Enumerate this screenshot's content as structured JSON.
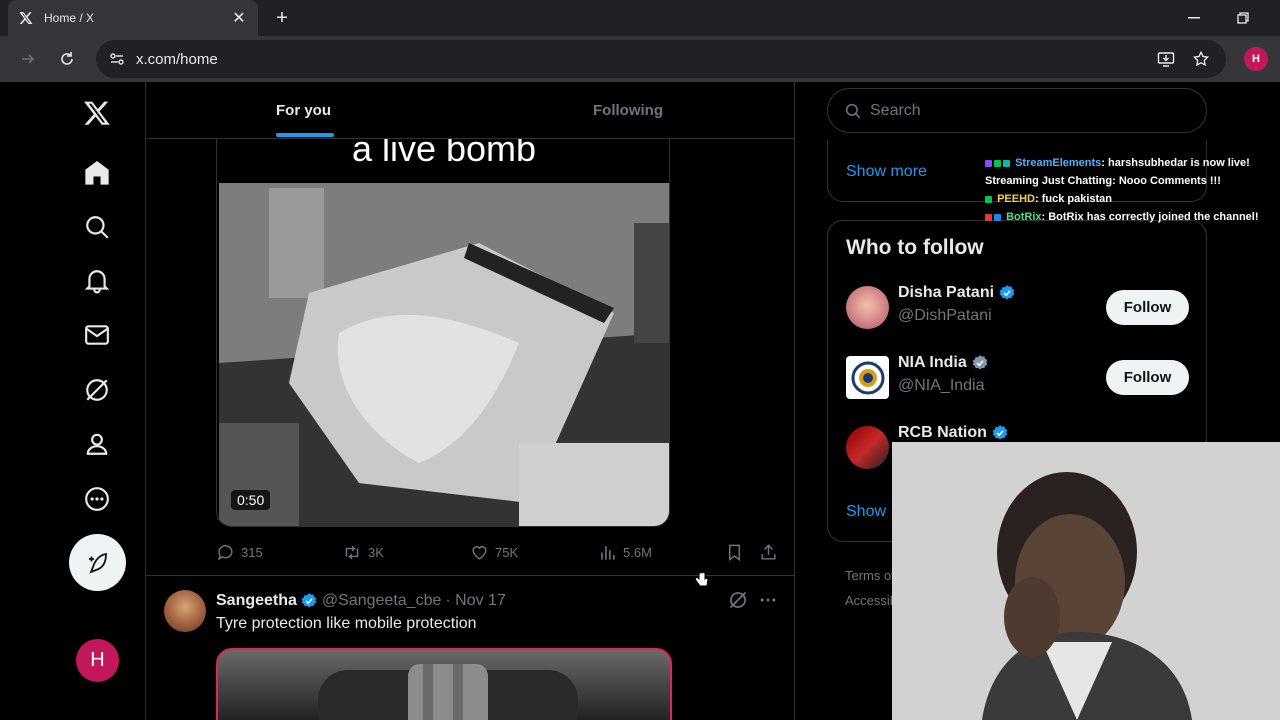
{
  "browser": {
    "tab_title": "Home / X",
    "url": "x.com/home",
    "profile_initial": "H"
  },
  "nav": {
    "user_initial": "H"
  },
  "feed": {
    "tabs": [
      {
        "label": "For you",
        "active": true
      },
      {
        "label": "Following",
        "active": false
      }
    ],
    "post1": {
      "media_caption": "a live bomb",
      "duration": "0:50",
      "replies": "315",
      "reposts": "3K",
      "likes": "75K",
      "views": "5.6M"
    },
    "post2": {
      "name": "Sangeetha",
      "handle": "@Sangeeta_cbe",
      "date": "· Nov 17",
      "text": "Tyre protection like mobile protection"
    }
  },
  "sidebar": {
    "search_placeholder": "Search",
    "show_more": "Show more",
    "who_to_follow": {
      "title": "Who to follow",
      "accounts": [
        {
          "name": "Disha Patani",
          "handle": "@DishPatani",
          "button": "Follow"
        },
        {
          "name": "NIA India",
          "handle": "@NIA_India",
          "button": "Follow"
        },
        {
          "name": "RCB Nation",
          "handle": "",
          "button": ""
        }
      ],
      "show_more": "Show"
    },
    "footer": {
      "line1": "Terms of",
      "line2": "Accessib"
    }
  },
  "chat": [
    {
      "user": "StreamElements",
      "message": ": harshsubhedar is now live! Streaming Just Chatting: Nooo Comments !!!"
    },
    {
      "user": "PEEHD",
      "message": ": fuck pakistan"
    },
    {
      "user": "BotRix",
      "message": ": BotRix has correctly joined the channel!"
    }
  ],
  "colors": {
    "accent": "#1d9bf0",
    "background": "#000000",
    "border": "#2f3336",
    "verified": "#1d9bf0",
    "verified_gov": "#829aab",
    "avatar_user": "#c2185b"
  },
  "icons": [
    "x-logo-icon",
    "home-icon",
    "search-icon",
    "bell-icon",
    "mail-icon",
    "grok-icon",
    "profile-icon",
    "more-icon",
    "compose-icon",
    "reply-icon",
    "repost-icon",
    "like-icon",
    "views-icon",
    "bookmark-icon",
    "share-icon",
    "verified-icon"
  ]
}
